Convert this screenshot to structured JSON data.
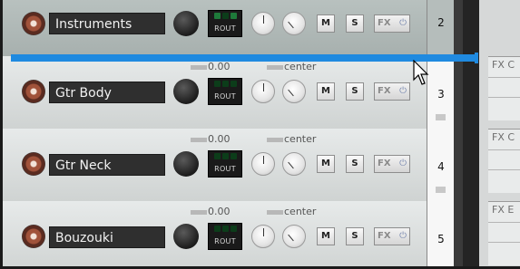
{
  "tracks": [
    {
      "number": "2",
      "name": "Instruments",
      "selected": true,
      "volume": "",
      "pan": "",
      "route": "ROUT",
      "mute": "M",
      "solo": "S",
      "fx": "FX"
    },
    {
      "number": "3",
      "name": "Gtr Body",
      "selected": false,
      "volume": "0.00",
      "pan": "center",
      "route": "ROUT",
      "mute": "M",
      "solo": "S",
      "fx": "FX"
    },
    {
      "number": "4",
      "name": "Gtr Neck",
      "selected": false,
      "volume": "0.00",
      "pan": "center",
      "route": "ROUT",
      "mute": "M",
      "solo": "S",
      "fx": "FX"
    },
    {
      "number": "5",
      "name": "Bouzouki",
      "selected": false,
      "volume": "0.00",
      "pan": "center",
      "route": "ROUT",
      "mute": "M",
      "solo": "S",
      "fx": "FX"
    }
  ],
  "mixer_slots": [
    {
      "label": "FX C"
    },
    {
      "label": "FX C"
    },
    {
      "label": "FX E"
    }
  ],
  "colors": {
    "drop_indicator": "#1f8ae0",
    "track_name_bg": "#2f2f2f",
    "selected_track": "#a7b0ae"
  },
  "icons": {
    "power": "power-icon",
    "cursor": "mouse-pointer-icon"
  }
}
